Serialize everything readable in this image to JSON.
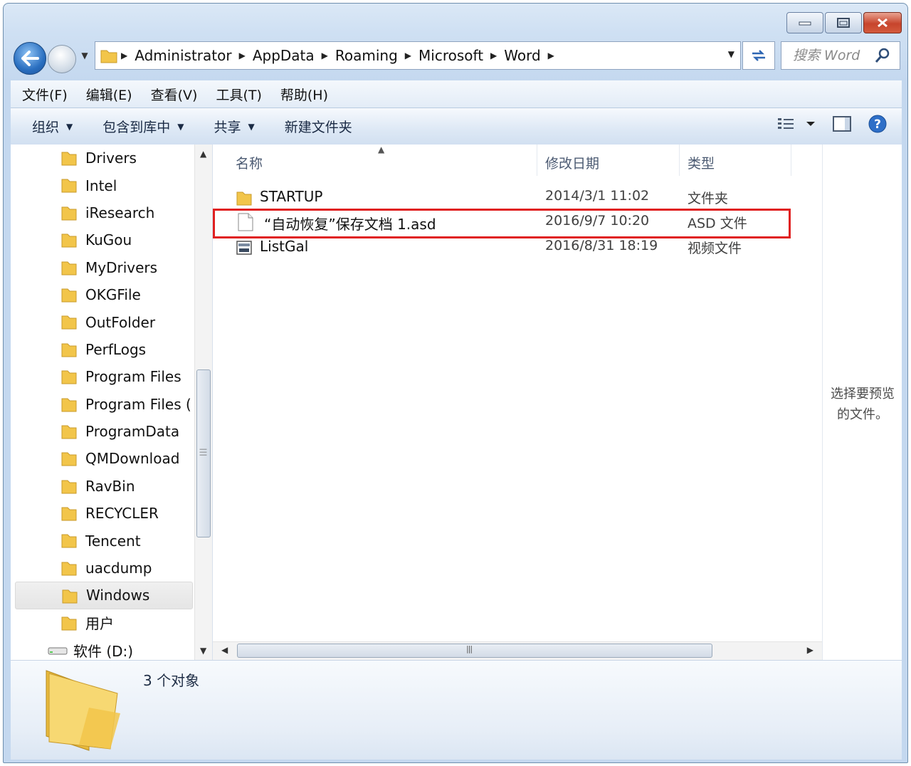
{
  "address": {
    "crumbs": [
      "Administrator",
      "AppData",
      "Roaming",
      "Microsoft",
      "Word"
    ]
  },
  "search": {
    "placeholder": "搜索 Word"
  },
  "menubar": {
    "items": [
      "文件(F)",
      "编辑(E)",
      "查看(V)",
      "工具(T)",
      "帮助(H)"
    ]
  },
  "toolbar": {
    "organize": "组织",
    "include_library": "包含到库中",
    "share": "共享",
    "new_folder": "新建文件夹"
  },
  "nav": {
    "items": [
      "Drivers",
      "Intel",
      "iResearch",
      "KuGou",
      "MyDrivers",
      "OKGFile",
      "OutFolder",
      "PerfLogs",
      "Program Files",
      "Program Files (",
      "ProgramData",
      "QMDownload",
      "RavBin",
      "RECYCLER",
      "Tencent",
      "uacdump",
      "Windows",
      "用户"
    ],
    "selected": "Windows",
    "drive": "软件 (D:)"
  },
  "columns": {
    "name": "名称",
    "date": "修改日期",
    "type": "类型"
  },
  "files": [
    {
      "name": "STARTUP",
      "date": "2014/3/1 11:02",
      "type": "文件夹",
      "icon": "folder-icon"
    },
    {
      "name": "“自动恢复”保存文档 1.asd",
      "date": "2016/9/7 10:20",
      "type": "ASD 文件",
      "icon": "blank-file-icon"
    },
    {
      "name": "ListGal",
      "date": "2016/8/31 18:19",
      "type": "视频文件",
      "icon": "video-file-icon"
    }
  ],
  "preview": {
    "line1": "选择要预览",
    "line2": "的文件。"
  },
  "details": {
    "count": "3 个对象"
  },
  "colors": {
    "highlight": "#e02020",
    "folder": "#f2c54a",
    "window_frame": "#c4d8ef"
  }
}
